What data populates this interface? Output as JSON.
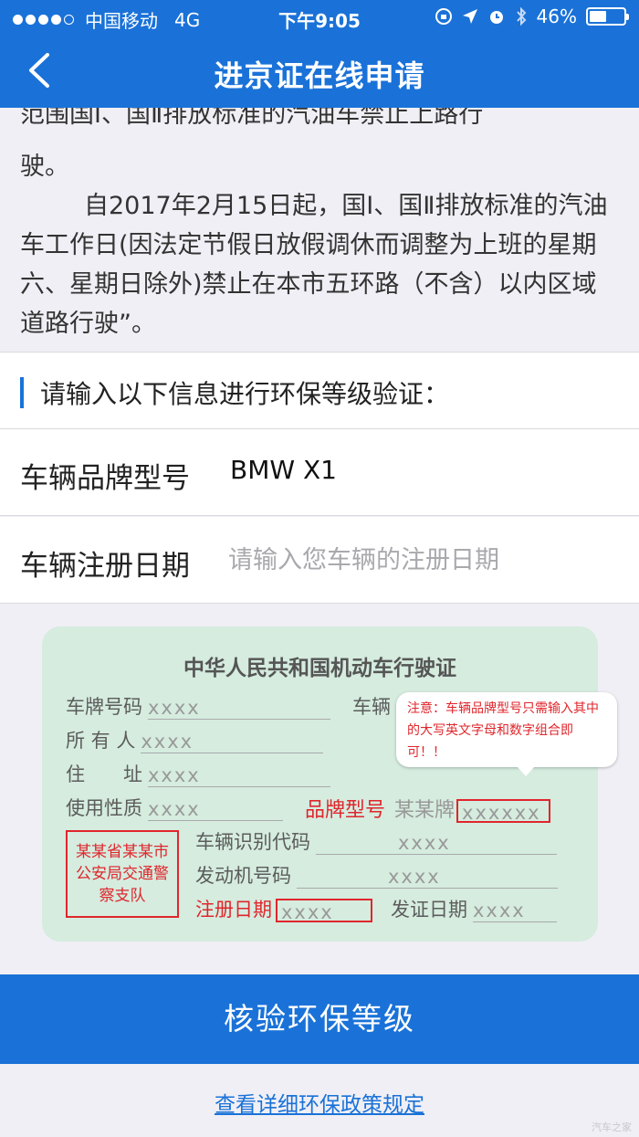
{
  "status_bar": {
    "carrier": "中国移动",
    "network": "4G",
    "time": "下午9:05",
    "battery": "46%"
  },
  "nav": {
    "title": "进京证在线申请"
  },
  "notice": {
    "clipped_line": "范围国Ⅰ、国Ⅱ排放标准的汽油车禁止上路行",
    "line1_end": "驶。",
    "para2": "自2017年2月15日起，国Ⅰ、国Ⅱ排放标准的汽油车工作日(因法定节假日放假调休而调整为上班的星期六、星期日除外)禁止在本市五环路（不含）以内区域道路行驶”。"
  },
  "form": {
    "section_title": "请输入以下信息进行环保等级验证：",
    "brand_label": "车辆品牌型号",
    "brand_value": "BMW X1",
    "date_label": "车辆注册日期",
    "date_placeholder": "请输入您车辆的注册日期"
  },
  "card": {
    "title": "中华人民共和国机动车行驶证",
    "plate_label": "车牌号码",
    "vehicle_label": "车辆",
    "owner_label": "所 有 人",
    "address_label": "住　　址",
    "usage_label": "使用性质",
    "brand_label": "品牌型号",
    "brand_prefix": "某某牌",
    "vin_label": "车辆识别代码",
    "engine_label": "发动机号码",
    "reg_date_label": "注册日期",
    "issue_date_label": "发证日期",
    "placeholder": "xxxx",
    "placeholder_long": "xxxxxx",
    "stamp": "某某省某某市公安局交通警察支队",
    "callout": "注意：车辆品牌型号只需输入其中的大写英文字母和数字组合即可！！"
  },
  "submit_label": "核验环保等级",
  "policy_link": "查看详细环保政策规定",
  "watermark": "汽车之家",
  "colors": {
    "primary": "#1a72d8",
    "card_bg": "#d5ecdf",
    "alert_red": "#e0262c"
  }
}
